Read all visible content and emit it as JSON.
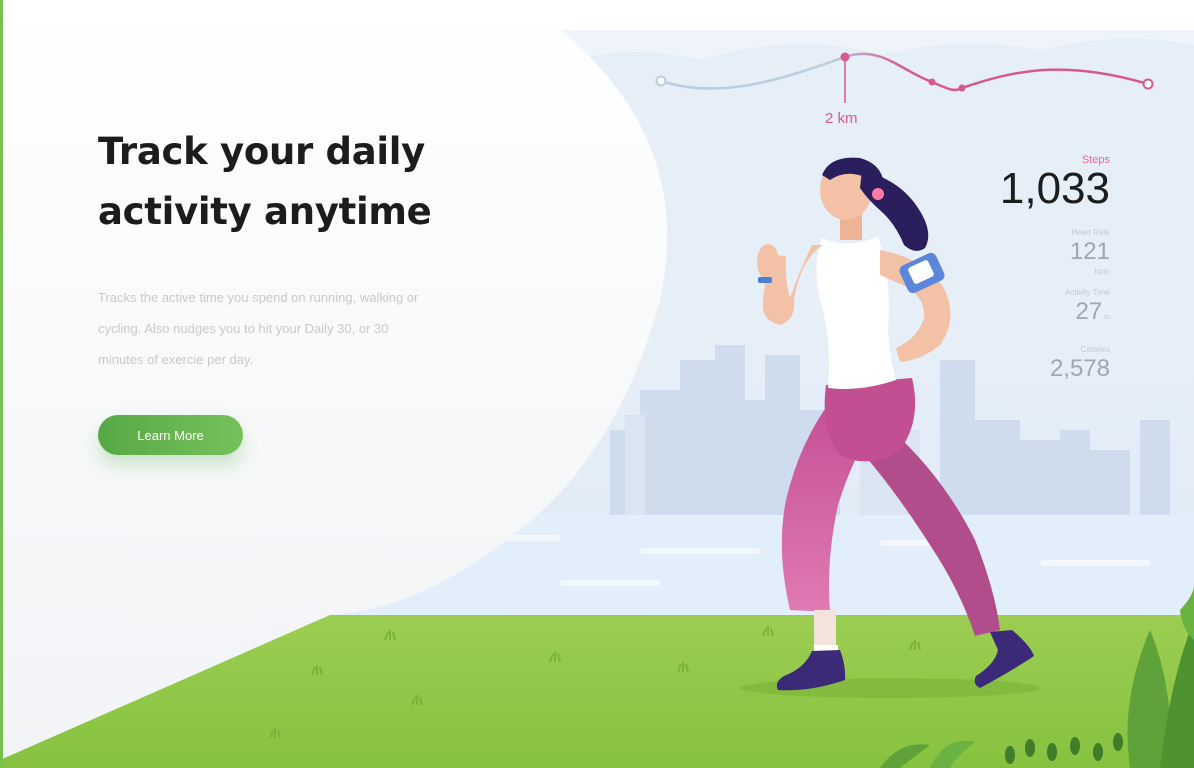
{
  "hero": {
    "headline_line1": "Track your daily",
    "headline_line2": "activity anytime",
    "description": "Tracks the active time you spend on running, walking or cycling. Also nudges you to hit your Daily 30, or 30 minutes of exercie per day.",
    "cta_label": "Learn More"
  },
  "route": {
    "marker_label": "2 km"
  },
  "stats": {
    "steps_label": "Steps",
    "steps_value": "1,033",
    "heart_rate_label": "Heart Rate",
    "heart_rate_value": "121",
    "heart_rate_unit": "bpm",
    "activity_time_label": "Activity Time",
    "activity_time_value": "27",
    "activity_time_unit": "m",
    "calories_label": "Calories",
    "calories_value": "2,578"
  },
  "colors": {
    "brand_green": "#66b34f",
    "accent_pink": "#d6588f",
    "grass": "#8cc63f",
    "pants": "#c9579a",
    "sky": "#e3eef8"
  }
}
